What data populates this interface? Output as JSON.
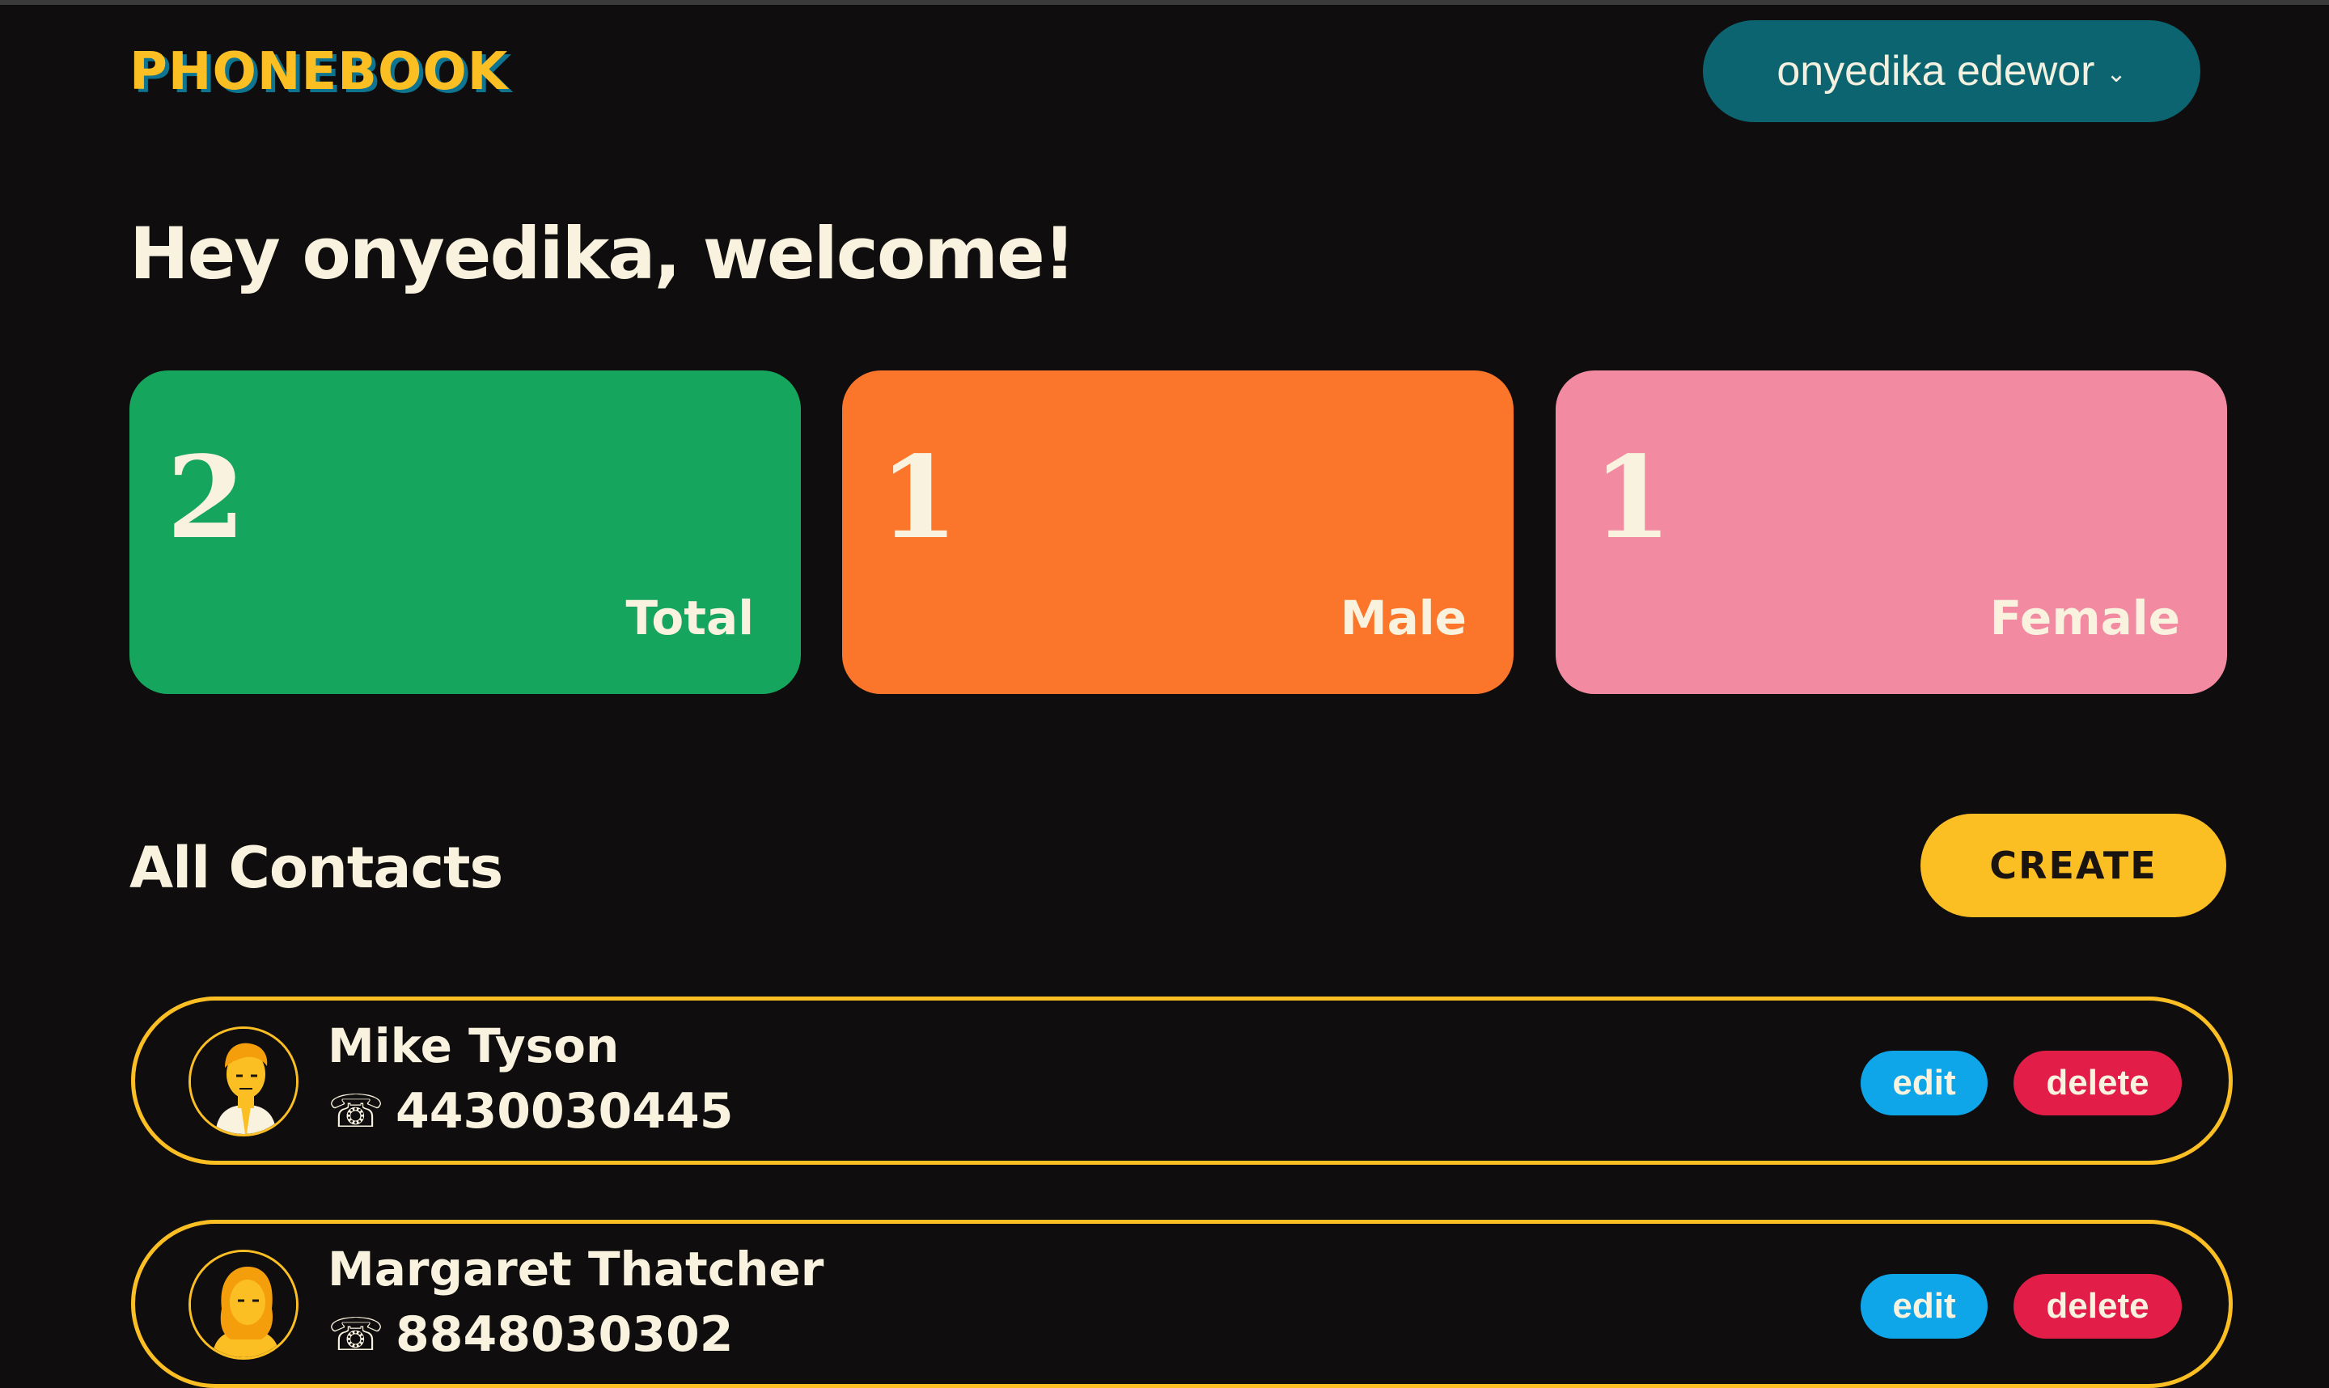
{
  "app": {
    "logo": "PHONEBOOK",
    "user_menu_label": "onyedika edewor"
  },
  "colors": {
    "background": "#0f0d0e",
    "accent_yellow": "#fbbf24",
    "user_menu": "#0b6470",
    "total_card": "#16a55c",
    "male_card": "#fb762b",
    "female_card": "#f28aa2",
    "edit_button": "#0ea5e9",
    "delete_button": "#e11d48"
  },
  "welcome": "Hey onyedika, welcome!",
  "stats": [
    {
      "value": "2",
      "label": "Total",
      "color": "#16a55c"
    },
    {
      "value": "1",
      "label": "Male",
      "color": "#fb762b"
    },
    {
      "value": "1",
      "label": "Female",
      "color": "#f28aa2"
    }
  ],
  "contacts_section": {
    "title": "All Contacts",
    "create_label": "CREATE"
  },
  "contacts": [
    {
      "name": "Mike Tyson",
      "phone": "4430030445",
      "edit_label": "edit",
      "delete_label": "delete",
      "avatar": "male-avatar"
    },
    {
      "name": "Margaret Thatcher",
      "phone": "8848030302",
      "edit_label": "edit",
      "delete_label": "delete",
      "avatar": "female-avatar"
    }
  ],
  "icons": {
    "user_menu": "chevron-down-icon",
    "phone": "telephone-icon"
  }
}
